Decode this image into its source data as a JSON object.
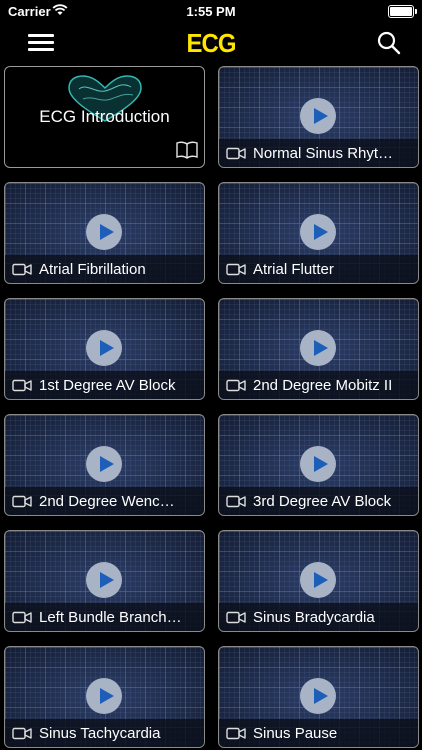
{
  "status": {
    "carrier": "Carrier",
    "time": "1:55 PM"
  },
  "nav": {
    "title": "ECG"
  },
  "intro": {
    "title": "ECG Introduction"
  },
  "videos": [
    {
      "label": "Normal Sinus Rhyt…"
    },
    {
      "label": "Atrial Fibrillation"
    },
    {
      "label": "Atrial Flutter"
    },
    {
      "label": "1st Degree AV Block"
    },
    {
      "label": "2nd Degree Mobitz II"
    },
    {
      "label": "2nd Degree Wenc…"
    },
    {
      "label": "3rd Degree AV Block"
    },
    {
      "label": "Left Bundle Branch…"
    },
    {
      "label": "Sinus Bradycardia"
    },
    {
      "label": "Sinus Tachycardia"
    },
    {
      "label": "Sinus Pause"
    }
  ],
  "colors": {
    "title_yellow": "#ffe500",
    "play_blue": "#1d5fb8",
    "card_bg": "#1e2b4a"
  }
}
